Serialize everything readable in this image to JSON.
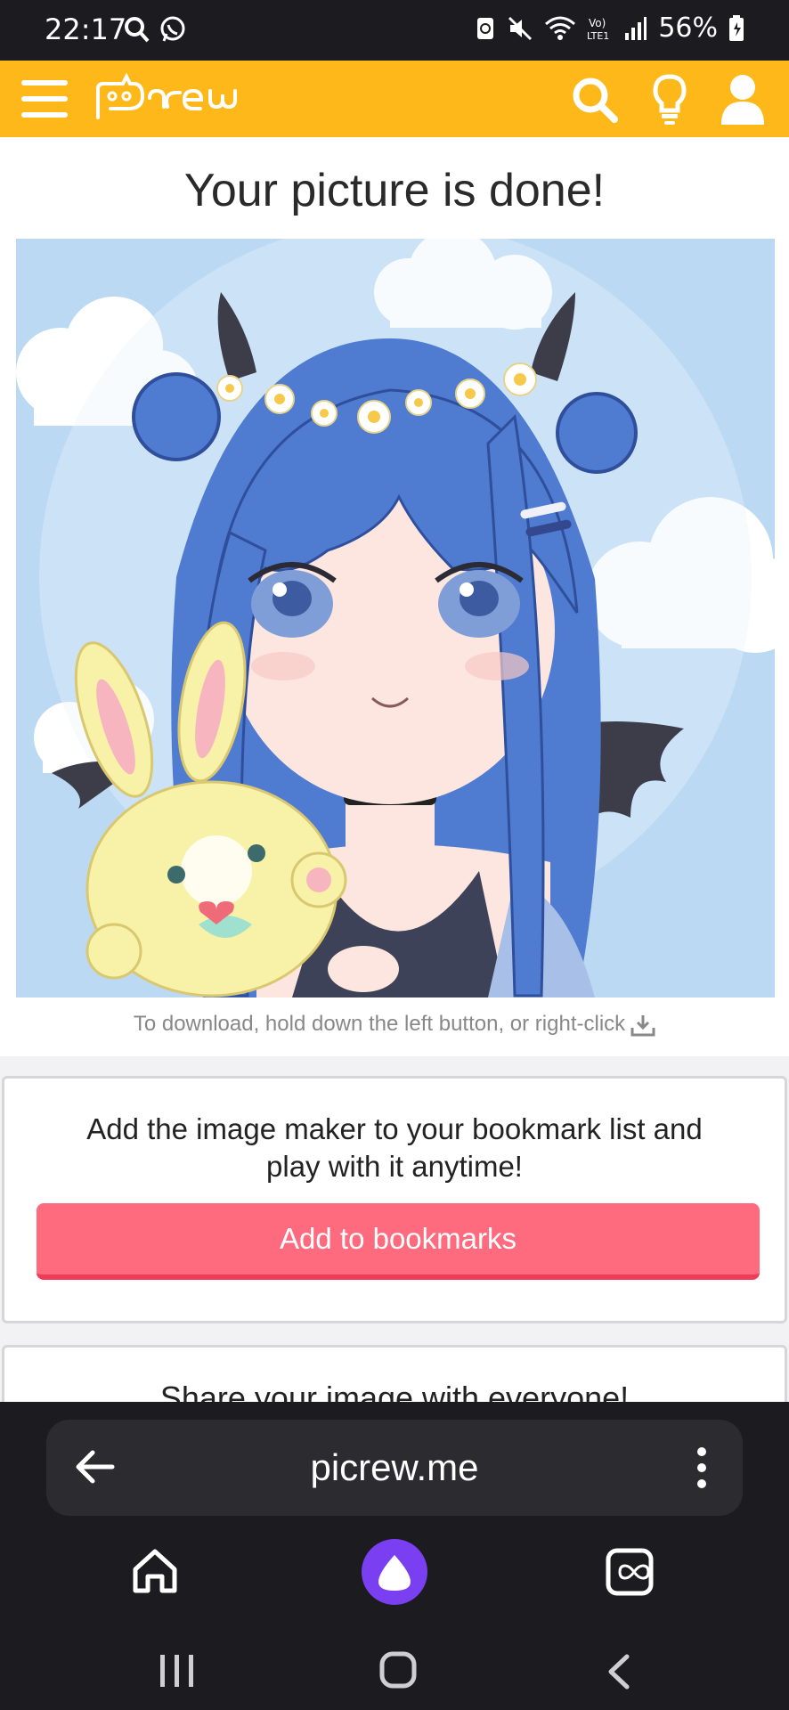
{
  "status_bar": {
    "time": "22:17",
    "battery": "56%",
    "icons": [
      "search-icon",
      "whatsapp-icon",
      "recycle-icon",
      "mute-icon",
      "wifi-icon",
      "volte-icon",
      "signal-icon",
      "battery-icon"
    ]
  },
  "app_header": {
    "logo_text": "Picrew",
    "background_color": "#ffb81a",
    "icons": [
      "menu-icon",
      "search-icon",
      "lightbulb-icon",
      "user-icon"
    ]
  },
  "result": {
    "title": "Your picture is done!",
    "download_hint": "To download, hold down the left button, or right-click"
  },
  "bookmark_card": {
    "text": "Add the image maker to your bookmark list and play with it anytime!",
    "button_label": "Add to bookmarks",
    "button_color": "#ff6b7e"
  },
  "share_card": {
    "text": "Share your image with everyone!"
  },
  "browser": {
    "url": "picrew.me",
    "icons": [
      "back-arrow-icon",
      "more-vert-icon",
      "home-icon",
      "alice-assistant-icon",
      "tabs-icon"
    ]
  },
  "system_nav": {
    "icons": [
      "recent-apps-icon",
      "home-button-icon",
      "back-icon"
    ]
  }
}
